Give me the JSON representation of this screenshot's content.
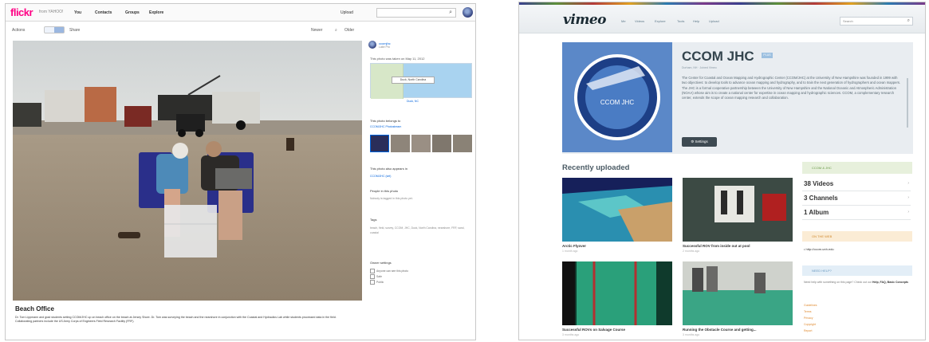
{
  "flickr": {
    "logo_part1": "flickr",
    "logo_part2": "",
    "logo_sub": "from YAHOO!",
    "nav": [
      "You",
      "Contacts",
      "Groups",
      "Explore"
    ],
    "upload_label": "Upload",
    "search_icon": "search-icon",
    "toolbar": {
      "actions_label": "Actions",
      "share_label": "Share",
      "newer_label": "Newer",
      "older_label": "Older"
    },
    "photo_title": "Beach Office",
    "photo_description": "Dr. Tom Lippmann and grad students setting CCOM/JHC up on beach office on the beach at Jersey Shore. Dr. Tom was surveying the beach and the nearshore in conjunction with the Coastal and Hydraulics Lab while students processed data in the field. Collaborating partners include the US Army Corps of Engineers Field Research Facility (FRF).",
    "owner_name": "ccomjhc",
    "owner_sub": "Lake Pro",
    "taken_text": "This photo was taken on May 11, 2012",
    "map_pin_label": "Duck, North Carolina",
    "map_place": "Duck, NC",
    "belongs_heading": "This photo belongs to",
    "belongs_link": "CCOM/JHC Photostream",
    "context_heading": "This photo also appears in",
    "context_link": "CCOM/JHC (set)",
    "people_heading": "People in this photo",
    "people_sub": "Nobody is tagged in this photo yet.",
    "tags_heading": "Tags",
    "tags_list": "beach, field, survey, CCOM, JHC, Duck, North Carolina, nearshore, FRF, sand, coastal",
    "owner_settings_heading": "Owner settings",
    "owner_settings": [
      "Anyone can see this photo",
      "Safe",
      "Public"
    ]
  },
  "vimeo": {
    "logo": "vimeo",
    "nav": [
      "Me",
      "Videos",
      "Explore",
      "Tools",
      "Help",
      "Upload"
    ],
    "search_placeholder": "Search",
    "search_icon": "search-icon",
    "channel_name": "CCOM JHC",
    "plus_badge": "PLUS",
    "meta_text": "Durham, NH · Joined Vimeo",
    "bio": "The Center for Coastal and Ocean Mapping and Hydrographic Center (CCOM/JHC) at the University of New Hampshire was founded in 1999 with two objectives: to develop tools to advance ocean mapping and hydrography, and to train the next generation of hydrographers and ocean mappers. The JHC is a formal cooperative partnership between the University of New Hampshire and the National Oceanic and Atmospheric Administration (NOAA) whose aim is to create a national center for expertise in ocean mapping and hydrographic sciences. CCOM, a complementary research center, extends the scope of ocean mapping research and collaboration.",
    "settings_label": "Settings",
    "badge_text": "CCOM JHC",
    "recent_title": "Recently uploaded",
    "videos": [
      {
        "title": "Arctic Flyover",
        "ago": "1 month ago"
      },
      {
        "title": "Successful ROV from inside out at pool",
        "ago": "2 months ago"
      },
      {
        "title": "Successful ROVs on Salvage Course",
        "ago": "3 months ago"
      },
      {
        "title": "Running the Obstacle Course and getting...",
        "ago": "3 months ago"
      }
    ],
    "rail": {
      "section_head": "CCOM & JHC",
      "stats": [
        "38 Videos",
        "3 Channels",
        "1 Album"
      ],
      "web_head": "ON THE WEB",
      "web_link": "http://ccom.unh.edu",
      "help_head": "NEED HELP?",
      "help_text_pre": "Need help with something on this page? Check out our",
      "help_text_link": "Help, FAQ, Basic Concepts",
      "footer_links": [
        "Guidelines",
        "Terms",
        "Privacy",
        "Copyright",
        "Report"
      ]
    }
  }
}
